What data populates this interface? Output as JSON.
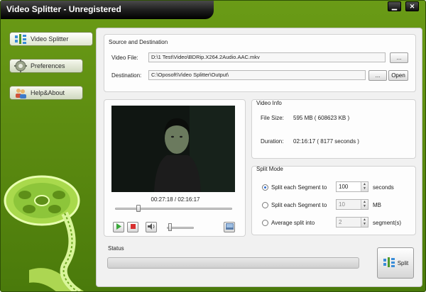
{
  "window": {
    "title": "Video Splitter - Unregistered",
    "minimize_glyph": "▁",
    "close_glyph": "✕"
  },
  "sidebar": {
    "items": [
      {
        "label": "Video Splitter",
        "icon": "splitter-icon",
        "active": true
      },
      {
        "label": "Preferences",
        "icon": "gear-icon",
        "active": false
      },
      {
        "label": "Help&About",
        "icon": "people-icon",
        "active": false
      }
    ]
  },
  "source": {
    "title": "Source and Destination",
    "video_file_label": "Video File:",
    "video_file_value": "D:\\1 Test\\Video\\BDRip.X264.2Audio.AAC.mkv",
    "browse_label": "...",
    "destination_label": "Destination:",
    "destination_value": "C:\\Oposoft\\Video Splitter\\Output\\",
    "dest_browse_label": "...",
    "open_label": "Open"
  },
  "player": {
    "timecode": "00:27:18 / 02:16:17",
    "position": 0.2,
    "volume": 0.1
  },
  "video_info": {
    "title": "Video Info",
    "file_size_label": "File Size:",
    "file_size_value": "595 MB ( 608623 KB )",
    "duration_label": "Duration:",
    "duration_value": "02:16:17 ( 8177 seconds )"
  },
  "split_mode": {
    "title": "Split Mode",
    "options": [
      {
        "label": "Split each Segment to",
        "value": "100",
        "unit": "seconds",
        "selected": true,
        "enabled": true
      },
      {
        "label": "Split each Segment to",
        "value": "10",
        "unit": "MB",
        "selected": false,
        "enabled": false
      },
      {
        "label": "Average split into",
        "value": "2",
        "unit": "segment(s)",
        "selected": false,
        "enabled": false
      }
    ]
  },
  "status": {
    "title": "Status",
    "progress": 0
  },
  "split_button": {
    "label": "Split"
  }
}
